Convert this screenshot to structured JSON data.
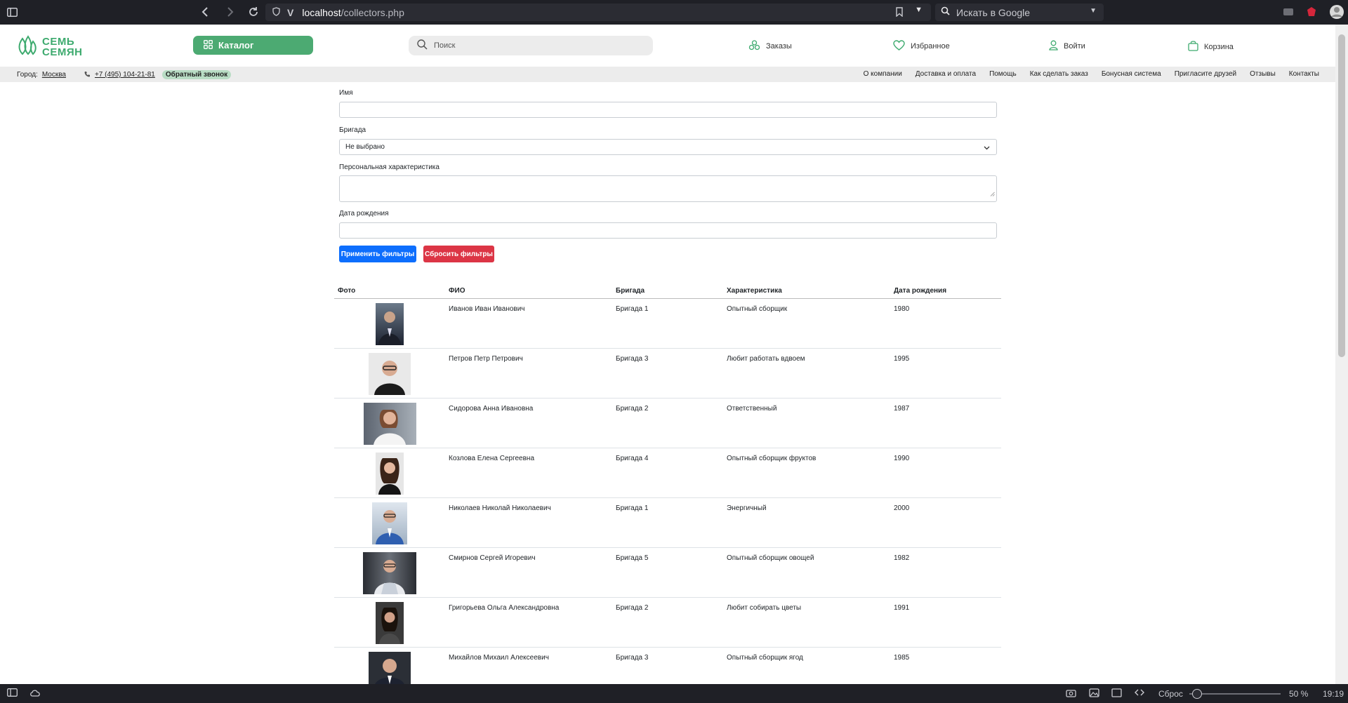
{
  "browser": {
    "url_host": "localhost",
    "url_path": "/collectors.php",
    "search_placeholder": "Искать в Google",
    "zoom": "50 %",
    "reset_label": "Сброс",
    "time": "19:19"
  },
  "header": {
    "logo_line1": "СЕМЬ",
    "logo_line2": "СЕМЯН",
    "catalog_label": "Каталог",
    "search_placeholder": "Поиск",
    "nav": {
      "orders": "Заказы",
      "favorites": "Избранное",
      "login": "Войти",
      "cart": "Корзина"
    }
  },
  "subbar": {
    "city_label": "Город:",
    "city": "Москва",
    "phone": "+7 (495) 104-21-81",
    "callback": "Обратный звонок",
    "links": [
      "О компании",
      "Доставка и оплата",
      "Помощь",
      "Как сделать заказ",
      "Бонусная система",
      "Пригласите друзей",
      "Отзывы",
      "Контакты"
    ]
  },
  "filters": {
    "name_label": "Имя",
    "brigade_label": "Бригада",
    "brigade_value": "Не выбрано",
    "trait_label": "Персональная характеристика",
    "birth_label": "Дата рождения",
    "apply_label": "Применить фильтры",
    "reset_label": "Сбросить фильтры"
  },
  "table": {
    "headers": {
      "photo": "Фото",
      "name": "ФИО",
      "brigade": "Бригада",
      "trait": "Характеристика",
      "birth": "Дата рождения"
    },
    "rows": [
      {
        "name": "Иванов Иван Иванович",
        "brigade": "Бригада 1",
        "trait": "Опытный сборщик",
        "birth": "1980"
      },
      {
        "name": "Петров Петр Петрович",
        "brigade": "Бригада 3",
        "trait": "Любит работать вдвоем",
        "birth": "1995"
      },
      {
        "name": "Сидорова Анна Ивановна",
        "brigade": "Бригада 2",
        "trait": "Ответственный",
        "birth": "1987"
      },
      {
        "name": "Козлова Елена Сергеевна",
        "brigade": "Бригада 4",
        "trait": "Опытный сборщик фруктов",
        "birth": "1990"
      },
      {
        "name": "Николаев Николай Николаевич",
        "brigade": "Бригада 1",
        "trait": "Энергичный",
        "birth": "2000"
      },
      {
        "name": "Смирнов Сергей Игоревич",
        "brigade": "Бригада 5",
        "trait": "Опытный сборщик овощей",
        "birth": "1982"
      },
      {
        "name": "Григорьева Ольга Александровна",
        "brigade": "Бригада 2",
        "trait": "Любит собирать цветы",
        "birth": "1991"
      },
      {
        "name": "Михайлов Михаил Алексеевич",
        "brigade": "Бригада 3",
        "trait": "Опытный сборщик ягод",
        "birth": "1985"
      }
    ]
  },
  "colors": {
    "brand_green": "#4caa72",
    "apply_blue": "#0d6efd",
    "reset_red": "#dc3545"
  }
}
